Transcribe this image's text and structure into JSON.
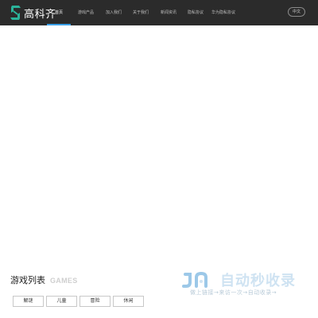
{
  "header": {
    "logo_text": "高科齐",
    "nav": [
      {
        "label": "首页",
        "active": true
      },
      {
        "label": "游戏产品",
        "active": false
      },
      {
        "label": "加入我们",
        "active": false
      },
      {
        "label": "关于我们",
        "active": false
      },
      {
        "label": "新闻资讯",
        "active": false
      },
      {
        "label": "隐私协议",
        "active": false
      },
      {
        "label": "华为隐私协议",
        "active": false
      }
    ],
    "lang_button": "中文"
  },
  "games_section": {
    "title": "游戏列表",
    "title_en": "GAMES",
    "filters": [
      "解谜",
      "儿童",
      "冒险",
      "休闲"
    ]
  },
  "watermark": {
    "logo_letters": "JR",
    "main_text": "自动秒收录",
    "sub_text": "做上链接→来访一次→自动收录→"
  },
  "colors": {
    "header_bg": "#2b2b2b",
    "accent": "#3aa0e8",
    "logo_green": "#2bb39a"
  }
}
